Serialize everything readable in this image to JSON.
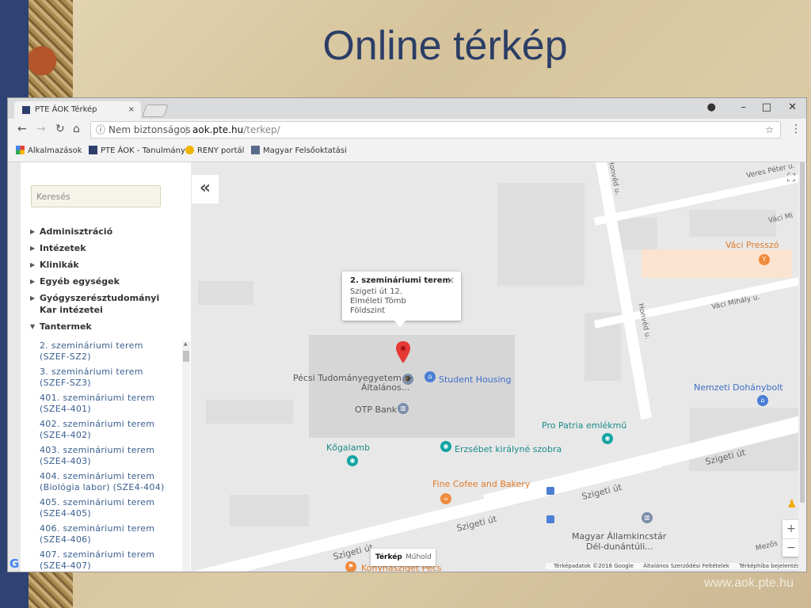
{
  "slide": {
    "title": "Online térkép",
    "footer_url": "www.aok.pte.hu"
  },
  "browser": {
    "tab_title": "PTE ÁOK Térkép",
    "tab_close": "×",
    "address": {
      "security_text": "Nem biztonságos",
      "host": "aok.pte.hu",
      "path": "/terkep/"
    },
    "bookmarks": [
      {
        "label": "Alkalmazások",
        "icon": "apps-icon"
      },
      {
        "label": "PTE ÁOK - Tanulmány",
        "icon": "pte-icon"
      },
      {
        "label": "RENY portál",
        "icon": "reny-icon"
      },
      {
        "label": "Magyar Felsőoktatási",
        "icon": "edu-icon"
      }
    ],
    "colors": {
      "accent": "#2e4273",
      "title": "#2c3e66",
      "link": "#3a5f8f"
    }
  },
  "sidebar": {
    "search_placeholder": "Keresés",
    "collapse_label": "«",
    "categories": [
      {
        "label": "Adminisztráció",
        "expanded": false
      },
      {
        "label": "Intézetek",
        "expanded": false
      },
      {
        "label": "Klinikák",
        "expanded": false
      },
      {
        "label": "Egyéb egységek",
        "expanded": false
      },
      {
        "label": "Gyógyszerésztudományi Kar intézetei",
        "expanded": false
      },
      {
        "label": "Tantermek",
        "expanded": true
      }
    ],
    "rooms": [
      "2. szemináriumi terem (SZEF-SZ2)",
      "3. szemináriumi terem (SZEF-SZ3)",
      "401. szemináriumi terem (SZE4-401)",
      "402. szemináriumi terem (SZE4-402)",
      "403. szemináriumi terem (SZE4-403)",
      "404. szemináriumi terem (Biológia labor) (SZE4-404)",
      "405. szemináriumi terem (SZE4-405)",
      "406. szemináriumi terem (SZE4-406)",
      "407. szemináriumi terem (SZE4-407)"
    ]
  },
  "map": {
    "popup": {
      "title": "2. szemináriumi terem",
      "line1": "Szigeti út 12.",
      "line2": "Elméleti Tömb",
      "line3": "Földszint",
      "close": "×"
    },
    "places": {
      "pte": "Pécsi Tudományegyetem",
      "pte2": "Általános...",
      "student_housing": "Student Housing",
      "otp": "OTP Bank",
      "kogalamb": "Kőgalamb",
      "erzsebet": "Erzsébet királyné szobra",
      "pro_patria": "Pro Patria emlékmű",
      "fine_cofee": "Fine Cofee and Bakery",
      "vaci_presszo": "Váci Presszó",
      "nemzeti": "Nemzeti Dohánybolt",
      "magyar1": "Magyar Államkincstár",
      "magyar2": "Dél-dunántúli...",
      "konyhasziget": "Konyhasziget Pécs"
    },
    "streets": {
      "honved1": "Honvéd u.",
      "honved2": "Honvéd u.",
      "vaci1": "Váci Mi",
      "vaci2": "Váci Mihály u.",
      "veres": "Veres Péter u.",
      "szigeti1": "Szigeti út",
      "szigeti2": "Szigeti út",
      "szigeti3": "Szigeti út",
      "szigeti4": "Szigeti út",
      "mezos": "Mezős"
    },
    "map_type": {
      "map": "Térkép",
      "satellite": "Műhold",
      "selected": "Térkép"
    },
    "zoom": {
      "in": "+",
      "out": "−"
    },
    "attribution": {
      "data": "Térképadatok ©2018 Google",
      "terms": "Általános Szerződési Feltételek",
      "report": "Térképhiba bejelentése"
    },
    "google": "G"
  }
}
